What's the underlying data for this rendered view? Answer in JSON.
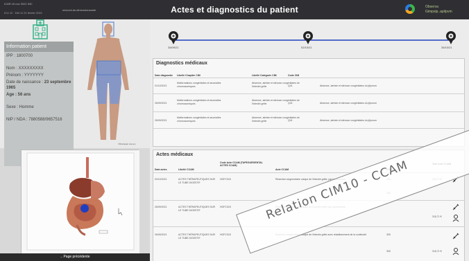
{
  "topbar": {
    "line1": "ICAR  16 nov 2021 INC",
    "line2": "ICU 11 · Dét 11 21 février 2021",
    "url": "nesvoni.ds.dimensionsante",
    "title": "Actes et diagnostics du patient",
    "brand_line1": "Observa",
    "brand_line2": "Gimpsip..apiIpvm",
    "accent": "#2f2f33"
  },
  "patient": {
    "header": "Information patient",
    "ipp": "IPP : 1800700",
    "nom": "Nom : XXXXXXXXX",
    "prenom": "Prénom : YYYYYYY",
    "naissance_label": "Date de naissance :",
    "naissance": "23 septembre",
    "naissance_year": "1965",
    "age": "Age : 56 ans",
    "sexe": "Sexe : Homme",
    "nip": "NIP / NDA : 7880588/9657516",
    "body_caption": "©BioDigital Human"
  },
  "back_button": "←Page précédente",
  "timeline": {
    "color": "#1f3fbf",
    "dates": [
      "26/09/21",
      "02/10/21",
      "26/10/21"
    ]
  },
  "diagnostics": {
    "title": "Diagnostics médicaux",
    "headers": [
      "Date diagnostic",
      "Libellé Chapitre CIM",
      "Libellé Catégorie CIM",
      "Code CIM"
    ],
    "rows": [
      {
        "date": "01/10/2021",
        "chapitre": "Malformations congénitales et anomalies chromosomiques",
        "categorie": "Absence, atrésie et sténose congénitales de l'intestin grêle",
        "code": "Q41",
        "libelle": "Absence, atrésie et sténose congénitales du jéjunum"
      },
      {
        "date": "26/09/2021",
        "chapitre": "Malformations congénitales et anomalies chromosomiques",
        "categorie": "Absence, atrésie et sténose congénitales de l'intestin grêle",
        "code": "Q41",
        "libelle": "Absence, atrésie et sténose congénitales du jéjunum"
      },
      {
        "date": "26/09/2021",
        "chapitre": "Malformations congénitales et anomalies chromosomiques",
        "categorie": "Absence, atrésie et sténose congénitales de l'intestin grêle",
        "code": "Q41",
        "libelle": "Absence, atrésie et sténose congénitales du jéjunum"
      }
    ]
  },
  "actes": {
    "title": "Actes médicaux",
    "headers": [
      "Date actes",
      "Libellé CCAM",
      "Code Acte CCAM (TAPEGURGENTAL ACTES CCAM)",
      "Acte CCAM",
      "ICR",
      "Tarif Acte CCAM"
    ],
    "rows": [
      {
        "date": "02/10/2021",
        "lib": "ACTES THÉRAPEUTIQUES SUR LE TUBE DIGESTIF",
        "code": "HGFC015",
        "acte": "Résection segmentaire unique de l'intestin grêle, par laparotomie",
        "icr1": "150",
        "icr2": "150",
        "tarif": "315,71 €"
      },
      {
        "date": "26/09/2021",
        "lib": "ACTES THÉRAPEUTIQUES SUR LE TUBE DIGESTIF",
        "code": "HGFC015",
        "acte": "Résection segmentaire unique de l'intestin grêle, par laparotomie",
        "icr1": "",
        "icr2": "",
        "tarif": "315,71 €"
      },
      {
        "date": "26/09/2021",
        "lib": "ACTES THÉRAPEUTIQUES SUR LE TUBE DIGESTIF",
        "code": "HGFC015",
        "acte": "Résection segmentaire unique de l'intestin grêle avec rétablissement de la continuité",
        "icr1": "300",
        "icr2": "300",
        "tarif": "315,71 €"
      }
    ]
  },
  "watermark": "Relation CIM10 - CCAM"
}
